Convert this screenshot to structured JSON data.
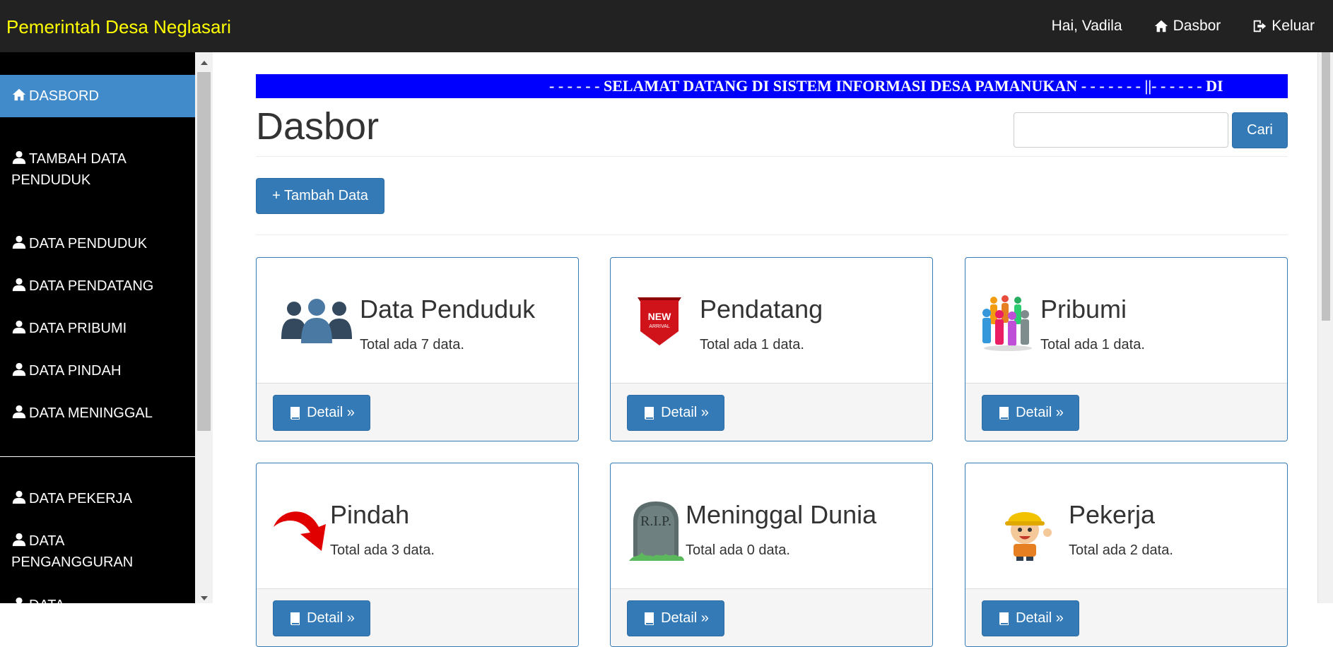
{
  "header": {
    "brand": "Pemerintah Desa Neglasari",
    "greeting": "Hai, Vadila",
    "dasbor_link": "Dasbor",
    "logout_link": "Keluar"
  },
  "sidebar": {
    "items": [
      {
        "label": "DASBORD",
        "icon": "home-icon",
        "active": true
      },
      {
        "label": "TAMBAH DATA PENDUDUK",
        "icon": "user-icon"
      },
      {
        "label": "DATA PENDUDUK",
        "icon": "user-icon"
      },
      {
        "label": "DATA PENDATANG",
        "icon": "user-icon"
      },
      {
        "label": "DATA PRIBUMI",
        "icon": "user-icon"
      },
      {
        "label": "DATA PINDAH",
        "icon": "user-icon"
      },
      {
        "label": "DATA MENINGGAL",
        "icon": "user-icon"
      },
      {
        "label": "DATA PEKERJA",
        "icon": "user-icon"
      },
      {
        "label": "DATA PENGANGGURAN",
        "icon": "user-icon"
      },
      {
        "label": "DATA",
        "icon": "user-icon"
      }
    ]
  },
  "marquee": {
    "text": "- - - - - - SELAMAT DATANG DI SISTEM INFORMASI DESA PAMANUKAN - - - - - - - ||- - - - - - DI"
  },
  "main": {
    "title": "Dasbor",
    "search": {
      "placeholder": "",
      "button": "Cari"
    },
    "add_button": "+ Tambah Data",
    "detail_label": "Detail »",
    "cards": [
      {
        "title": "Data Penduduk",
        "count_text": "Total ada 7 data.",
        "icon": "people-group-icon"
      },
      {
        "title": "Pendatang",
        "count_text": "Total ada 1 data.",
        "icon": "new-arrival-ribbon-icon"
      },
      {
        "title": "Pribumi",
        "count_text": "Total ada 1 data.",
        "icon": "crowd-colorful-icon"
      },
      {
        "title": "Pindah",
        "count_text": "Total ada 3 data.",
        "icon": "curved-arrow-icon"
      },
      {
        "title": "Meninggal Dunia",
        "count_text": "Total ada 0 data.",
        "icon": "rip-tombstone-icon"
      },
      {
        "title": "Pekerja",
        "count_text": "Total ada 2 data.",
        "icon": "construction-worker-icon"
      }
    ]
  },
  "colors": {
    "navbar": "#222222",
    "brand": "#ffff00",
    "primary": "#337ab7",
    "sidebar_active": "#428bca",
    "marquee_bg": "#0000ff"
  }
}
